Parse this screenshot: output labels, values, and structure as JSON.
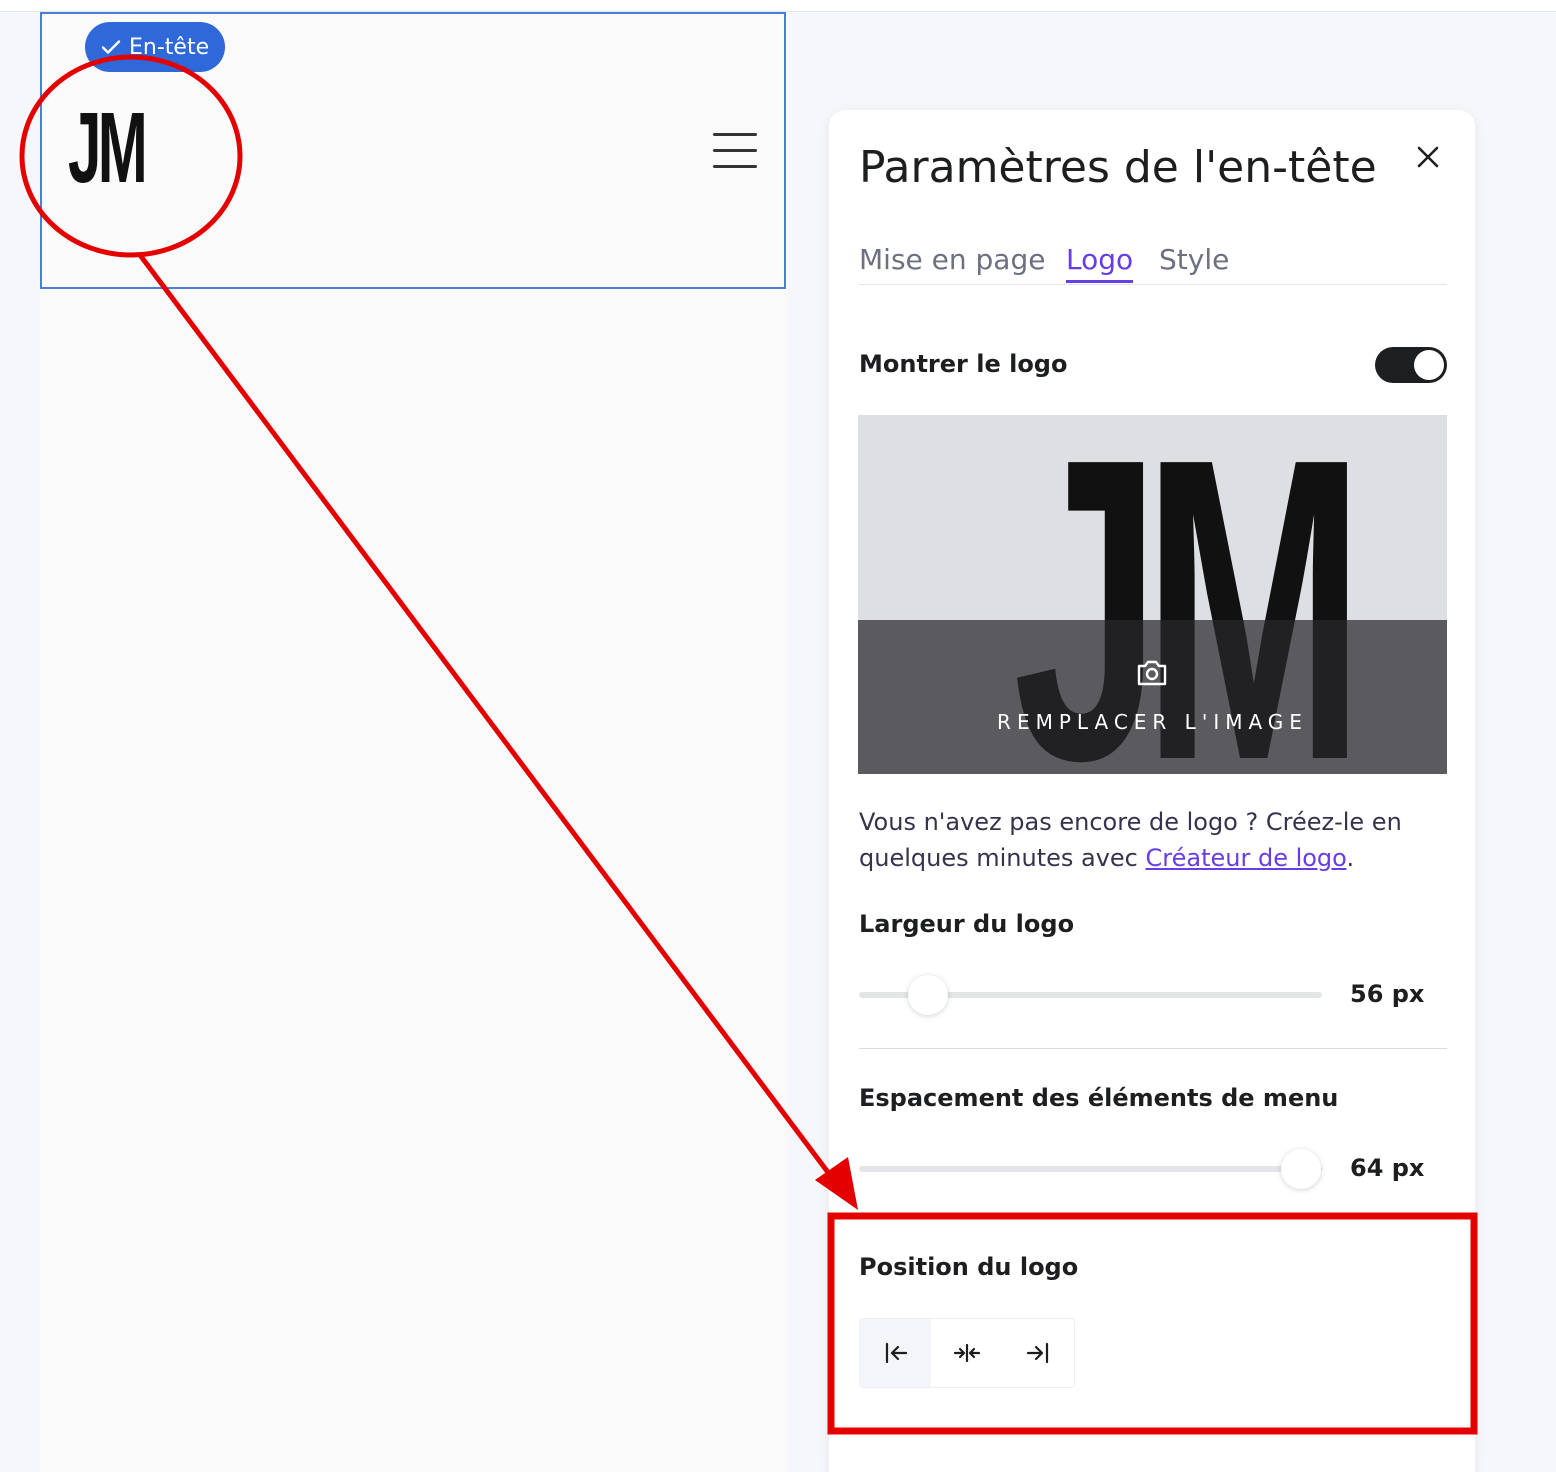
{
  "canvas": {
    "section_badge": "En-tête",
    "site_logo": "JM"
  },
  "panel": {
    "title": "Paramètres de l'en-tête",
    "tabs": [
      {
        "label": "Mise en page",
        "active": false
      },
      {
        "label": "Logo",
        "active": true
      },
      {
        "label": "Style",
        "active": false
      }
    ],
    "show_logo": {
      "label": "Montrer le logo",
      "enabled": true
    },
    "logo_preview": {
      "logo_text": "JM",
      "replace_label": "REMPLACER L'IMAGE"
    },
    "help": {
      "text": "Vous n'avez pas encore de logo ? Créez-le en quelques minutes avec ",
      "link": "Créateur de logo",
      "suffix": "."
    },
    "logo_width": {
      "label": "Largeur du logo",
      "value": "56 px",
      "fraction": 0.15
    },
    "menu_spacing": {
      "label": "Espacement des éléments de menu",
      "value": "64 px",
      "fraction": 0.955
    },
    "logo_position": {
      "label": "Position du logo",
      "options": [
        "left",
        "center",
        "right"
      ],
      "selected": "left"
    }
  },
  "colors": {
    "accent": "#673de6",
    "badge": "#2f69d9",
    "selection_border": "#4a7fd6",
    "annotation": "#e50000"
  }
}
